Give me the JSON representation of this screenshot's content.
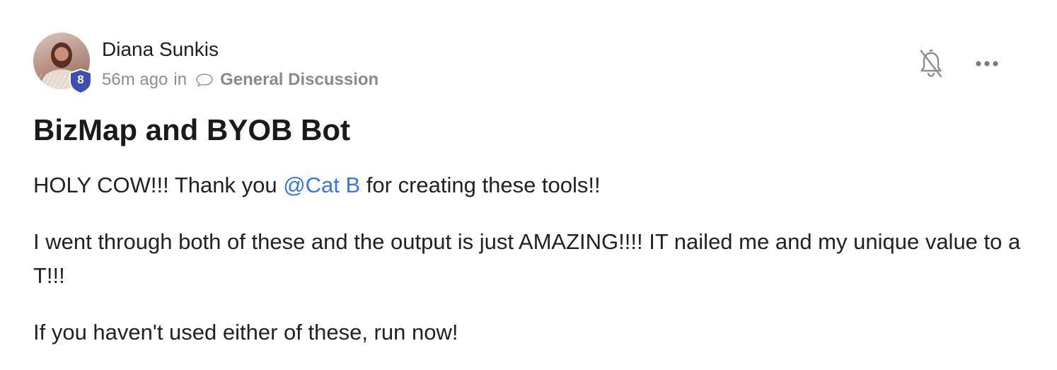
{
  "author": {
    "name": "Diana Sunkis",
    "level": "8",
    "avatar": "profile-photo"
  },
  "meta": {
    "time": "56m ago",
    "in_label": "in",
    "category": "General Discussion",
    "category_icon": "speech-bubble-icon"
  },
  "actions": {
    "notifications_icon": "bell-off-icon",
    "more_icon": "more-horizontal-icon"
  },
  "post": {
    "title": "BizMap and BYOB Bot",
    "paragraph1": {
      "before": "HOLY COW!!! Thank you ",
      "mention": "@Cat B",
      "after": " for creating these tools!!"
    },
    "paragraph2": "I went through both of these and the output is just AMAZING!!!! IT nailed me and my unique value to a T!!!",
    "paragraph3": "If you haven't used either of these, run now!"
  },
  "colors": {
    "mention": "#3b76db",
    "badge": "#3f4fb0",
    "meta_text": "#8e8e8e"
  }
}
